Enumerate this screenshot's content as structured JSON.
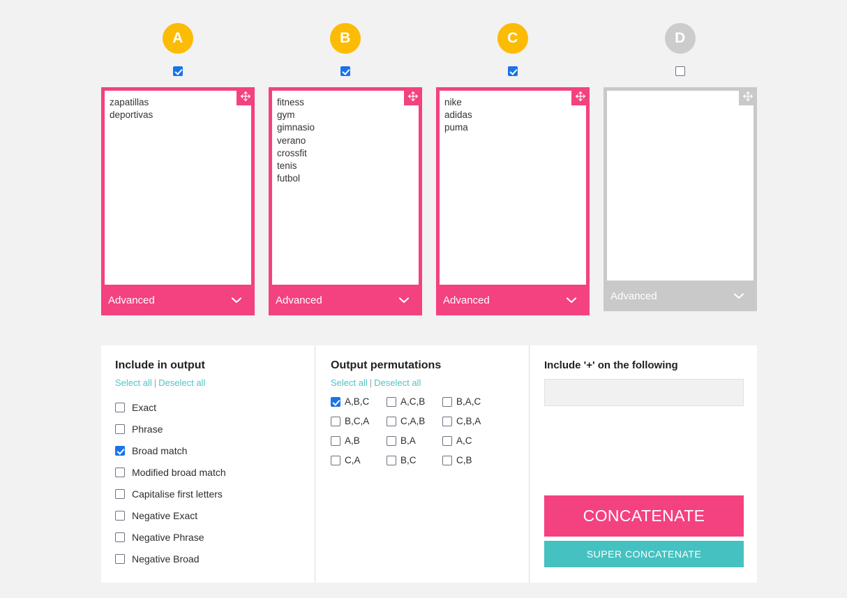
{
  "columns": [
    {
      "badge": "A",
      "enabled_checkbox": true,
      "keywords": "zapatillas\ndeportivas",
      "advanced_label": "Advanced",
      "disabled": false,
      "move_handle_icon": "move-arrows-icon",
      "chevron_icon": "chevron-down-icon"
    },
    {
      "badge": "B",
      "enabled_checkbox": true,
      "keywords": "fitness\ngym\ngimnasio\nverano\ncrossfit\ntenis\nfutbol",
      "advanced_label": "Advanced",
      "disabled": false,
      "move_handle_icon": "move-arrows-icon",
      "chevron_icon": "chevron-down-icon"
    },
    {
      "badge": "C",
      "enabled_checkbox": true,
      "keywords": "nike\nadidas\npuma",
      "advanced_label": "Advanced",
      "disabled": false,
      "move_handle_icon": "move-arrows-icon",
      "chevron_icon": "chevron-down-icon"
    },
    {
      "badge": "D",
      "enabled_checkbox": false,
      "keywords": "",
      "advanced_label": "Advanced",
      "disabled": true,
      "move_handle_icon": "move-arrows-icon",
      "chevron_icon": "chevron-down-icon"
    }
  ],
  "include_in_output": {
    "title": "Include in output",
    "select_all": "Select all",
    "separator": "|",
    "deselect_all": "Deselect all",
    "options": [
      {
        "label": "Exact",
        "checked": false
      },
      {
        "label": "Phrase",
        "checked": false
      },
      {
        "label": "Broad match",
        "checked": true
      },
      {
        "label": "Modified broad match",
        "checked": false
      },
      {
        "label": "Capitalise first letters",
        "checked": false
      },
      {
        "label": "Negative Exact",
        "checked": false
      },
      {
        "label": "Negative Phrase",
        "checked": false
      },
      {
        "label": "Negative Broad",
        "checked": false
      }
    ]
  },
  "output_permutations": {
    "title": "Output permutations",
    "select_all": "Select all",
    "separator": "|",
    "deselect_all": "Deselect all",
    "options": [
      {
        "label": "A,B,C",
        "checked": true
      },
      {
        "label": "A,C,B",
        "checked": false
      },
      {
        "label": "B,A,C",
        "checked": false
      },
      {
        "label": "B,C,A",
        "checked": false
      },
      {
        "label": "C,A,B",
        "checked": false
      },
      {
        "label": "C,B,A",
        "checked": false
      },
      {
        "label": "A,B",
        "checked": false
      },
      {
        "label": "B,A",
        "checked": false
      },
      {
        "label": "A,C",
        "checked": false
      },
      {
        "label": "C,A",
        "checked": false
      },
      {
        "label": "B,C",
        "checked": false
      },
      {
        "label": "C,B",
        "checked": false
      }
    ]
  },
  "plus_section": {
    "title": "Include '+' on the following",
    "input_value": "",
    "input_placeholder": "",
    "concatenate_label": "CONCATENATE",
    "super_concatenate_label": "SUPER CONCATENATE"
  },
  "colors": {
    "accent_pink": "#f4417f",
    "accent_teal": "#45c1c1",
    "badge_yellow": "#fcbc05",
    "badge_disabled": "#cccccc",
    "checkbox_blue": "#1a73e8",
    "link_teal": "#4ec3c3",
    "page_background": "#f2f2f2",
    "panel_background": "#ffffff",
    "disabled_gray": "#c9c9c9"
  }
}
